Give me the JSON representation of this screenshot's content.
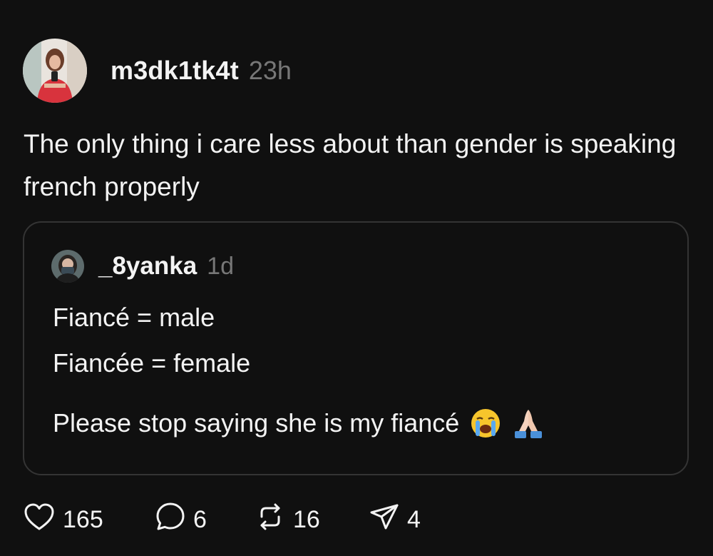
{
  "post": {
    "author": "m3dk1tk4t",
    "time": "23h",
    "text": "The only thing i care less about than gender is speaking french properly"
  },
  "quoted_post": {
    "author": "_8yanka",
    "time": "1d",
    "line1": "Fiancé = male",
    "line2": "Fiancée = female",
    "line3": "Please stop saying she is my fiancé"
  },
  "actions": {
    "likes": "165",
    "replies": "6",
    "reposts": "16",
    "shares": "4"
  },
  "icons": {
    "like": "heart-icon",
    "reply": "comment-bubble-icon",
    "repost": "repost-arrows-icon",
    "share": "send-paper-plane-icon",
    "emoji1": "crying-face-emoji",
    "emoji2": "folded-hands-emoji"
  }
}
